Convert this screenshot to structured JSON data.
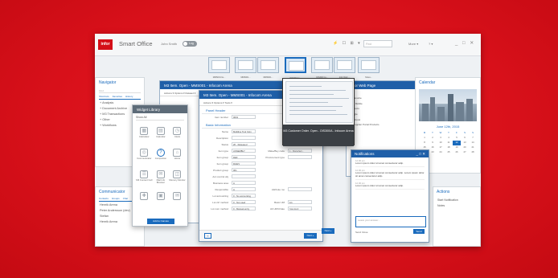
{
  "app": {
    "logo": "infor",
    "title": "Smart Office",
    "user": "John Smith",
    "toggle": "Log off",
    "top_icons": "⚡ ☐ ⊞ ▾",
    "search_placeholder": "Find",
    "more": "More ▾",
    "help": "? ▾",
    "window_controls": "_ □ ✕"
  },
  "taskbar": [
    {
      "label": "MMS001 Ite..."
    },
    {
      "label": "MMS001..."
    },
    {
      "label": "MMS001..."
    },
    {
      "label": "OIS300 Cu..."
    },
    {
      "label": "OIS300 Cu..."
    },
    {
      "label": "Infor Web ..."
    },
    {
      "label": "Notes..."
    }
  ],
  "navigator": {
    "title": "Navigator",
    "search": "Find",
    "tabs": [
      "Shortcuts",
      "Favorites",
      "History"
    ],
    "items": [
      "Analysis",
      "Document Archive",
      "M3 Transactions",
      "Other",
      "Workflows"
    ]
  },
  "communicator": {
    "title": "Communicator",
    "tabs": [
      "Contacts",
      "Groups",
      "Chat"
    ],
    "contacts": [
      "Henrik Arena",
      "Peter Andersson (dev)",
      "Stefan",
      "Henrik Arena"
    ]
  },
  "widget_library": {
    "title": "Widget Library",
    "filter": "Show All",
    "widgets": [
      {
        "icon": "▦",
        "label": "Calculator"
      },
      {
        "icon": "▤",
        "label": "Calendar"
      },
      {
        "icon": "◷",
        "label": "Clock"
      },
      {
        "icon": "◎",
        "label": "Communicator"
      },
      {
        "icon": "?",
        "label": "Companion"
      },
      {
        "icon": "⌂",
        "label": "Home"
      },
      {
        "icon": "☰",
        "label": "M3 Content Cell"
      },
      {
        "icon": "✉",
        "label": "Mail Info Browser"
      },
      {
        "icon": "◫",
        "label": "Memory Monitor"
      },
      {
        "icon": "✚",
        "label": ""
      },
      {
        "icon": "▣",
        "label": ""
      },
      {
        "icon": "✉",
        "label": ""
      }
    ],
    "add_button": "Add to Canvas"
  },
  "m3_item": {
    "title": "M3 Item. Open - MMS001 - Infocom Arena",
    "tools": "Actions ▾   Options ▾   Related ▾"
  },
  "m3_customer": {
    "title": "M3 Item. Open - MMS001 - Infocom Arena",
    "tools": "Actions ▾   Options ▾   Tools ▾",
    "section1": "Panel Header",
    "section2": "Basic Information",
    "fields": [
      {
        "label": "Item number",
        "value": "0001",
        "label2": "",
        "value2": ""
      },
      {
        "label": "Name",
        "value": "Multiline Tool Cstn",
        "label2": "",
        "value2": ""
      },
      {
        "label": "Description",
        "value": "",
        "label2": "",
        "value2": ""
      },
      {
        "label": "Status",
        "value": "20 - Released",
        "label2": "",
        "value2": ""
      },
      {
        "label": "Item type",
        "value": "ASSEMBLY",
        "label2": "Make/Buy code",
        "value2": "1 - Manufact..."
      },
      {
        "label": "Item group",
        "value": "DEF",
        "label2": "Procurement type",
        "value2": ""
      },
      {
        "label": "Item group",
        "value": "RAW1",
        "label2": "",
        "value2": ""
      },
      {
        "label": "Product group",
        "value": "001",
        "label2": "",
        "value2": ""
      },
      {
        "label": "Acc control obj",
        "value": "",
        "label2": "",
        "value2": ""
      },
      {
        "label": "Business area",
        "value": "A",
        "label2": "",
        "value2": ""
      },
      {
        "label": "Responsible",
        "value": "A",
        "label2": "Attribute mo",
        "value2": ""
      },
      {
        "label": "Lot accounting",
        "value": "0 - No accounting",
        "label2": "",
        "value2": ""
      },
      {
        "label": "Lot ctrl method",
        "value": "0 - Not used",
        "label2": "Basic UM",
        "value2": "EA"
      },
      {
        "label": "Lot num method",
        "value": "0 - Manual entry",
        "label2": "Alt UM/U/rate",
        "value2": "Standard"
      }
    ],
    "prev": "«",
    "next": "Next »",
    "status": "Infocom Arena / LOCAL001 / ..."
  },
  "web_window": {
    "title": "Infor Web Page",
    "items": [
      "My favorite",
      "Infor Mobile",
      "Products",
      "Google",
      "Facebook",
      "All Supplier Portal Products"
    ]
  },
  "preview": {
    "caption": "M3 Customer Order. Open - OIS300/A - Infocom Arena"
  },
  "calendar": {
    "title": "Calendar",
    "month": "June 12th, 2015",
    "day_headers": [
      "M",
      "T",
      "W",
      "T",
      "F",
      "S",
      "S"
    ],
    "days": [
      "1",
      "2",
      "3",
      "4",
      "5",
      "6",
      "7",
      "8",
      "9",
      "10",
      "11",
      "12",
      "13",
      "14",
      "15",
      "16",
      "17",
      "18",
      "19",
      "20",
      "21",
      "22",
      "23",
      "24",
      "25",
      "26",
      "27",
      "28"
    ],
    "today": "12"
  },
  "notifications": {
    "title": "Notifications",
    "controls": "_ □ ✕",
    "notes": [
      {
        "time": "12.00 pm",
        "body": "Lorem ipsum dolor sit amet consectetur adip."
      },
      {
        "time": "12.00 pm",
        "body": "Lorem ipsum dolor sit amet consectetur adip. Lorem ipsum dolor sit amet consectetur adip."
      },
      {
        "time": "12.00 pm",
        "body": "Lorem ipsum dolor sit amet consectetur adip."
      }
    ],
    "reply_placeholder": "Leave your answer...",
    "footer": "Send Close",
    "send": "Send"
  },
  "right_low": {
    "title": "Actions",
    "items": [
      "Start Notification",
      "Notes"
    ]
  },
  "back_next": "Next »"
}
